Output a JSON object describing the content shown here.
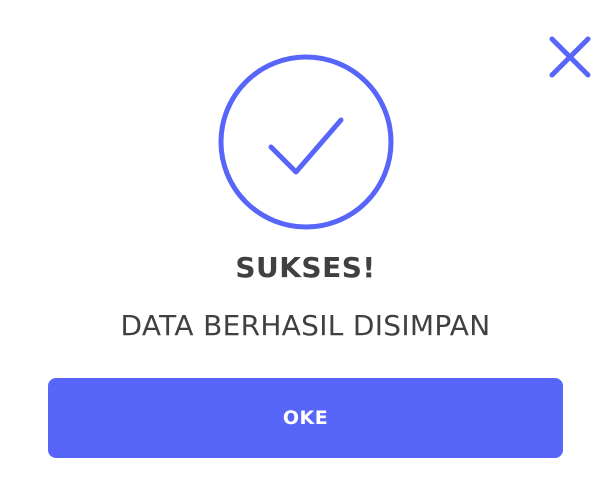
{
  "dialog": {
    "title": "SUKSES!",
    "message": "DATA BERHASIL DISIMPAN",
    "ok_label": "OKE",
    "close_icon": "close-icon",
    "status_icon": "check-circle-icon"
  },
  "colors": {
    "accent": "#5865f9",
    "text": "#404040",
    "background": "#ffffff",
    "button_text": "#ffffff"
  }
}
